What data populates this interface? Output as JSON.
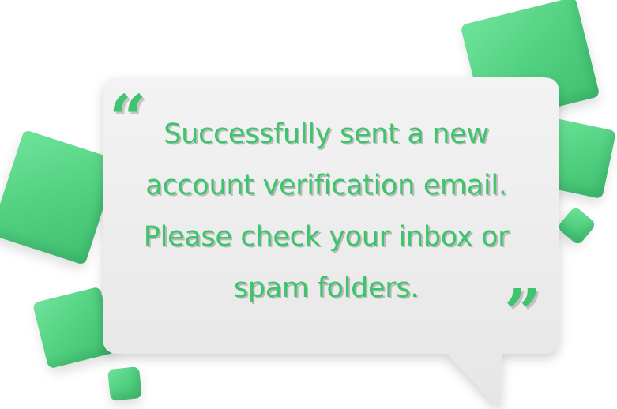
{
  "message": {
    "text": "Successfully sent a new account verification email. Please check your inbox or spam folders."
  },
  "quotes": {
    "open": "“",
    "close": "”"
  },
  "colors": {
    "accent": "#40c46f",
    "bubble": "#efefef",
    "background": "#ffffff"
  }
}
